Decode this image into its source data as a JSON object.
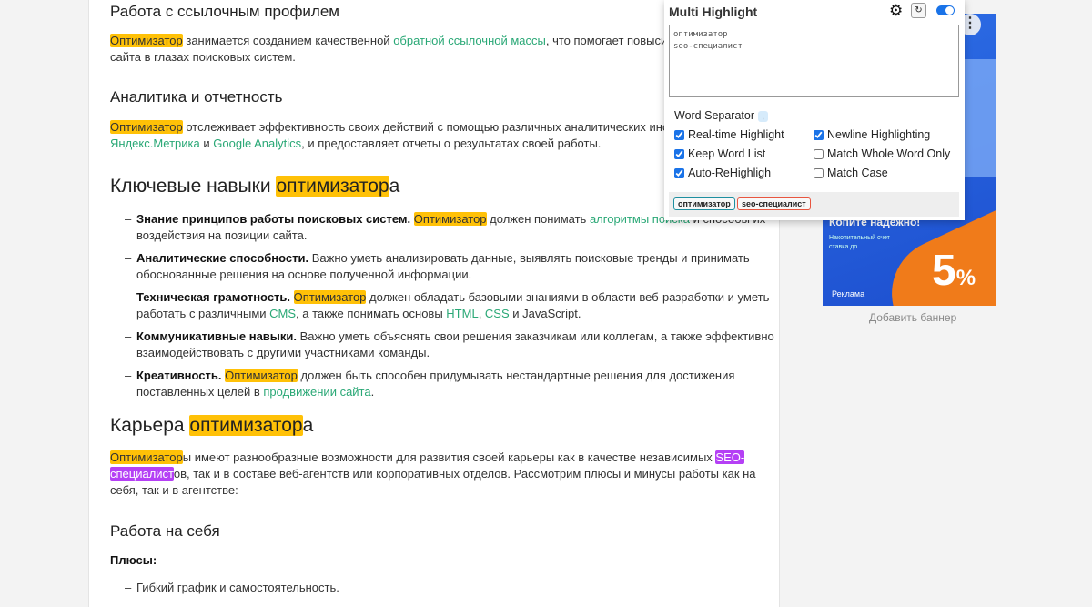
{
  "article": {
    "h_links": "Работа с ссылочным профилем",
    "p1": {
      "hl": "Оптимизатор",
      "t1": " занимается созданием качественной ",
      "link": "обратной ссылочной массы",
      "t2": ", что помогает повысить а",
      "l2": "сайта в глазах поисковых систем."
    },
    "h_analytics": "Аналитика и отчетность",
    "p2": {
      "hl": "Оптимизатор",
      "t1": " отслеживает эффективность своих действий с помощью различных аналитических инстру",
      "link1": "Яндекс.Метрика",
      "and": " и ",
      "link2": "Google Analytics",
      "t2": ", и предоставляет отчеты о результатах своей работы."
    },
    "h_skills": {
      "pre": "Ключевые навыки ",
      "hl": "оптимизатор",
      "post": "а"
    },
    "skills": [
      {
        "b": "Знание принципов работы поисковых систем.",
        "hl": "Оптимизатор",
        "t1": " должен понимать ",
        "link": "алгоритмы поиска",
        "t2": " и способы их",
        "l2": "воздействия на позиции сайта."
      },
      {
        "b": "Аналитические способности.",
        "t1": " Важно уметь анализировать данные, выявлять поисковые тренды и принимать",
        "l2": "обоснованные решения на основе полученной информации."
      },
      {
        "b": "Техническая грамотность.",
        "hl": "Оптимизатор",
        "t1": " должен обладать базовыми знаниями в области веб-разработки и уметь",
        "l2a": "работать с различными ",
        "cms": "CMS",
        "l2b": ", а также понимать основы ",
        "html": "HTML",
        "comma": ", ",
        "css": "CSS",
        "l2c": " и JavaScript."
      },
      {
        "b": "Коммуникативные навыки.",
        "t1": " Важно уметь объяснять свои решения заказчикам или коллегам, а также эффективно",
        "l2": "взаимодействовать с другими участниками команды."
      },
      {
        "b": "Креативность.",
        "hl": "Оптимизатор",
        "t1": " должен быть способен придумывать нестандартные решения для достижения",
        "l2": "поставленных целей в ",
        "link": "продвижении сайта",
        "dot": "."
      }
    ],
    "h_career": {
      "pre": "Карьера ",
      "hl": "оптимизатор",
      "post": "а"
    },
    "p3": {
      "hl": "Оптимизатор",
      "t1": "ы имеют разнообразные возможности для развития своей карьеры как в качестве независимых ",
      "hp1": "SEO-",
      "hp2": "специалист",
      "t2": "ов, так и в составе веб-агентств или корпоративных отделов. Рассмотрим плюсы и минусы работы как на",
      "l3": "себя, так и в агентстве:"
    },
    "h_self": "Работа на себя",
    "pros": "Плюсы:",
    "pro1": "Гибкий график и самостоятельность.",
    "dash": "–"
  },
  "ad": {
    "menu": "⋮",
    "headline": "Копите надежно!",
    "sub": "Накопительный счет ставка до",
    "big": "5",
    "pct": "%",
    "label": "Реклама",
    "add_banner": "Добавить баннер"
  },
  "popup": {
    "title": "Multi Highlight",
    "gear_icon": "gear-icon",
    "refresh_icon": "refresh-icon",
    "refresh": "↻",
    "words": "оптимизатор\nseo-специалист",
    "separator_label": "Word Separator",
    "separator": ",",
    "options": [
      {
        "label": "Real-time Highlight",
        "checked": true
      },
      {
        "label": "Newline Highlighting",
        "checked": true
      },
      {
        "label": "Keep Word List",
        "checked": true
      },
      {
        "label": "Match Whole Word Only",
        "checked": false
      },
      {
        "label": "Auto-ReHighligh",
        "checked": true
      },
      {
        "label": "Match Case",
        "checked": false
      }
    ],
    "tags": [
      {
        "word": "оптимизатор",
        "color": "#1e8fa0"
      },
      {
        "word": "seo-специалист",
        "color": "#e8553f"
      }
    ],
    "enabled": true
  }
}
